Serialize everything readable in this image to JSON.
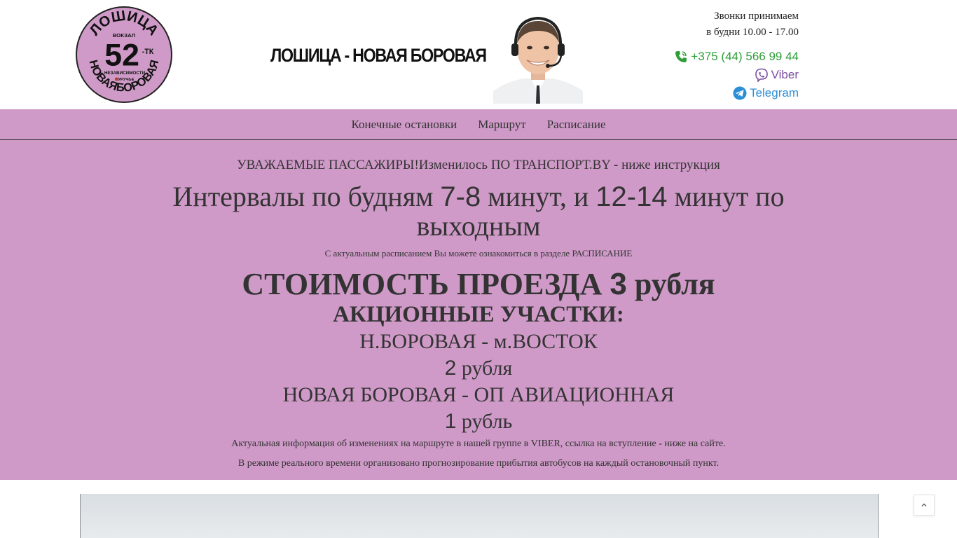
{
  "logo": {
    "top_text": "ЛОШИЦА",
    "route_number": "52",
    "route_suffix": "-ТК",
    "small_text_1": "ВОКЗАЛ",
    "small_text_2": "НЕЗАВИСИМОСТИ",
    "small_text_3": "УРУЧЬЕ",
    "bottom_text": "НОВАЯБОРОВАЯ"
  },
  "header": {
    "route_title": "ЛОШИЦА - НОВАЯ БОРОВАЯ",
    "hours_line1": "Звонки принимаем",
    "hours_line2": "в будни 10.00 - 17.00",
    "phone": "+375 (44) 566 99 44",
    "viber": "Viber",
    "telegram": "Telegram"
  },
  "nav": {
    "items": [
      "Конечные остановки",
      "Маршрут",
      "Расписание"
    ]
  },
  "main": {
    "notice": "УВАЖАЕМЫЕ ПАССАЖИРЫ!Изменилось ПО ТРАНСПОРТ.BY - ниже инструкция",
    "intervals_a": "Интервалы по будням  ",
    "intervals_num1": "7-8",
    "intervals_b": " минут,  и ",
    "intervals_num2": "12-14",
    "intervals_c": " минут по выходным",
    "schedule_note": "С актуальным расписанием Вы можете ознакомиться в разделе РАСПИСАНИЕ",
    "price_a": "СТОИМОСТЬ ПРОЕЗДА ",
    "price_num": "3",
    "price_b": "  рубля",
    "promo_title": "АКЦИОННЫЕ УЧАСТКИ:",
    "seg1": "Н.БОРОВАЯ - м.ВОСТОК",
    "seg1_num": "2",
    "seg1_unit": " рубля",
    "seg2": "НОВАЯ БОРОВАЯ -  ОП АВИАЦИОННАЯ",
    "seg2_num": "1",
    "seg2_unit": " рубль",
    "info1": "Актуальная информация об изменениях на маршруте в нашей группе в VIBER, ссылка на вступление - ниже на сайте.",
    "info2": "В режиме реального времени организовано прогнозирование прибытия автобусов на каждый остановочный пункт."
  },
  "colors": {
    "accent_purple": "#cf9ac8",
    "phone_green": "#2f9e3a",
    "viber_purple": "#7d4ea3",
    "telegram_blue": "#2a8fd6"
  },
  "icons": {
    "phone": "phone-icon",
    "viber": "viber-icon",
    "telegram": "telegram-icon",
    "scroll_top": "chevron-up-icon"
  }
}
